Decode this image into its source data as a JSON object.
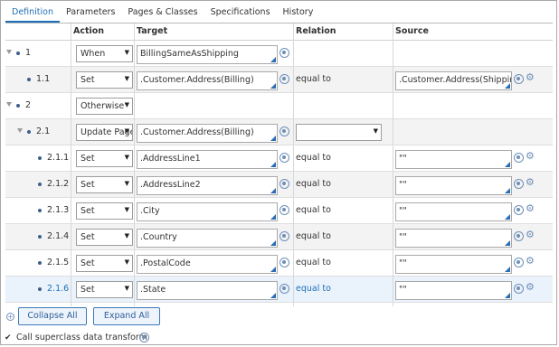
{
  "tabs": [
    "Definition",
    "Parameters",
    "Pages & Classes",
    "Specifications",
    "History"
  ],
  "columns": {
    "action": "Action",
    "target": "Target",
    "relation": "Relation",
    "source": "Source"
  },
  "rows": [
    {
      "num": "1",
      "action": "When",
      "target": "BillingSameAsShipping",
      "relation": "",
      "source": ""
    },
    {
      "num": "1.1",
      "action": "Set",
      "target": ".Customer.Address(Billing)",
      "relation": "equal to",
      "source": ".Customer.Address(Shipping)"
    },
    {
      "num": "2",
      "action": "Otherwise",
      "target": "",
      "relation": "",
      "source": ""
    },
    {
      "num": "2.1",
      "action": "Update Page",
      "target": ".Customer.Address(Billing)",
      "relation": "",
      "source": ""
    },
    {
      "num": "2.1.1",
      "action": "Set",
      "target": ".AddressLine1",
      "relation": "equal to",
      "source": "\"\""
    },
    {
      "num": "2.1.2",
      "action": "Set",
      "target": ".AddressLine2",
      "relation": "equal to",
      "source": "\"\""
    },
    {
      "num": "2.1.3",
      "action": "Set",
      "target": ".City",
      "relation": "equal to",
      "source": "\"\""
    },
    {
      "num": "2.1.4",
      "action": "Set",
      "target": ".Country",
      "relation": "equal to",
      "source": "\"\""
    },
    {
      "num": "2.1.5",
      "action": "Set",
      "target": ".PostalCode",
      "relation": "equal to",
      "source": "\"\""
    },
    {
      "num": "2.1.6",
      "action": "Set",
      "target": ".State",
      "relation": "equal to",
      "source": "\"\""
    }
  ],
  "footer": {
    "collapse_all": "Collapse All",
    "expand_all": "Expand All"
  },
  "superclass": {
    "label": "Call superclass data transform",
    "checked": true
  },
  "colors": {
    "accent": "#1f6fb7",
    "icon": "#6e8fb8"
  }
}
